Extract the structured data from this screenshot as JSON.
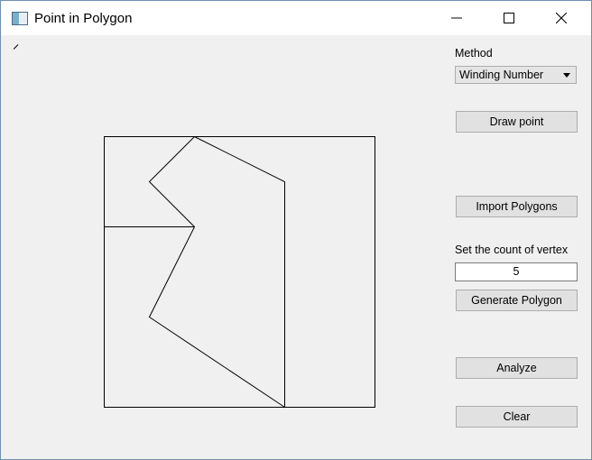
{
  "window": {
    "title": "Point in Polygon"
  },
  "icons": {
    "app": "app-icon",
    "minimize": "minimize-icon",
    "maximize": "maximize-icon",
    "close": "close-icon",
    "combo_arrow": "dropdown-arrow-icon",
    "cursor": "cursor-mark-icon"
  },
  "panel": {
    "method_label": "Method",
    "method_selected": "Winding Number",
    "draw_point": "Draw point",
    "import_polygons": "Import Polygons",
    "vertex_label": "Set the count of vertex",
    "vertex_value": "5",
    "generate_polygon": "Generate Polygon",
    "analyze": "Analyze",
    "clear": "Clear"
  }
}
